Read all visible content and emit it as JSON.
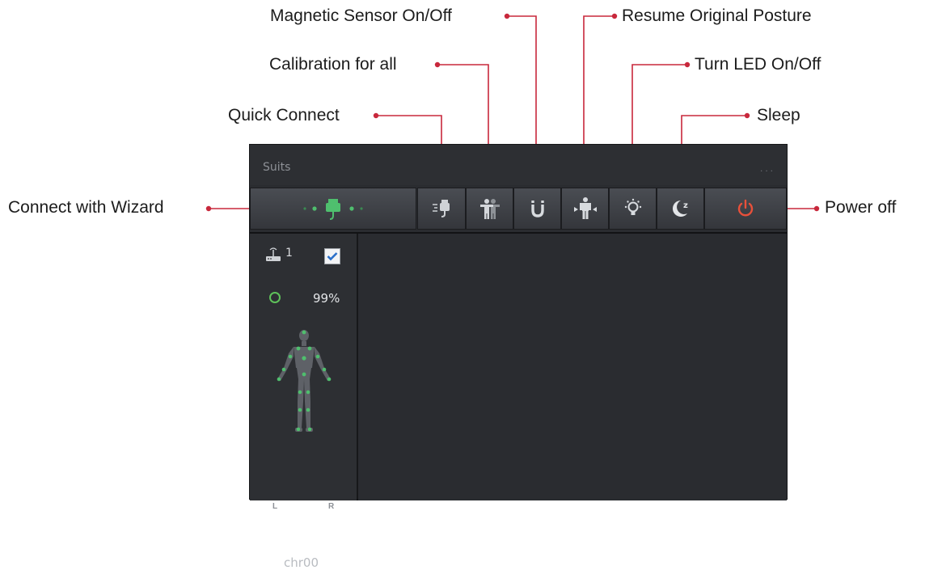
{
  "callouts": {
    "magnetic_sensor": "Magnetic Sensor On/Off",
    "resume_posture": "Resume Original Posture",
    "calibration_all": "Calibration for all",
    "turn_led": "Turn LED On/Off",
    "quick_connect": "Quick Connect",
    "sleep": "Sleep",
    "connect_wizard": "Connect with Wizard",
    "power_off": "Power off"
  },
  "panel": {
    "title": "Suits",
    "more": "...",
    "toolbar": [
      {
        "id": "connect-wizard",
        "icon": "usb-plug-dots-icon"
      },
      {
        "id": "quick-connect",
        "icon": "usb-plug-icon"
      },
      {
        "id": "calibration-all",
        "icon": "figures-icon"
      },
      {
        "id": "magnetic-sensor",
        "icon": "magnet-icon"
      },
      {
        "id": "resume-posture",
        "icon": "figure-arrows-icon"
      },
      {
        "id": "turn-led",
        "icon": "bulb-icon"
      },
      {
        "id": "sleep",
        "icon": "moon-z-icon"
      },
      {
        "id": "power-off",
        "icon": "power-icon"
      }
    ],
    "suit": {
      "number": "1",
      "checked": true,
      "battery": "99%",
      "left_label": "L",
      "right_label": "R",
      "name": "chr00"
    }
  },
  "colors": {
    "accent_red": "#c8283c",
    "battery_green": "#5ec15a",
    "power_red": "#e8503a",
    "sensor_green": "#4fbf6e"
  }
}
